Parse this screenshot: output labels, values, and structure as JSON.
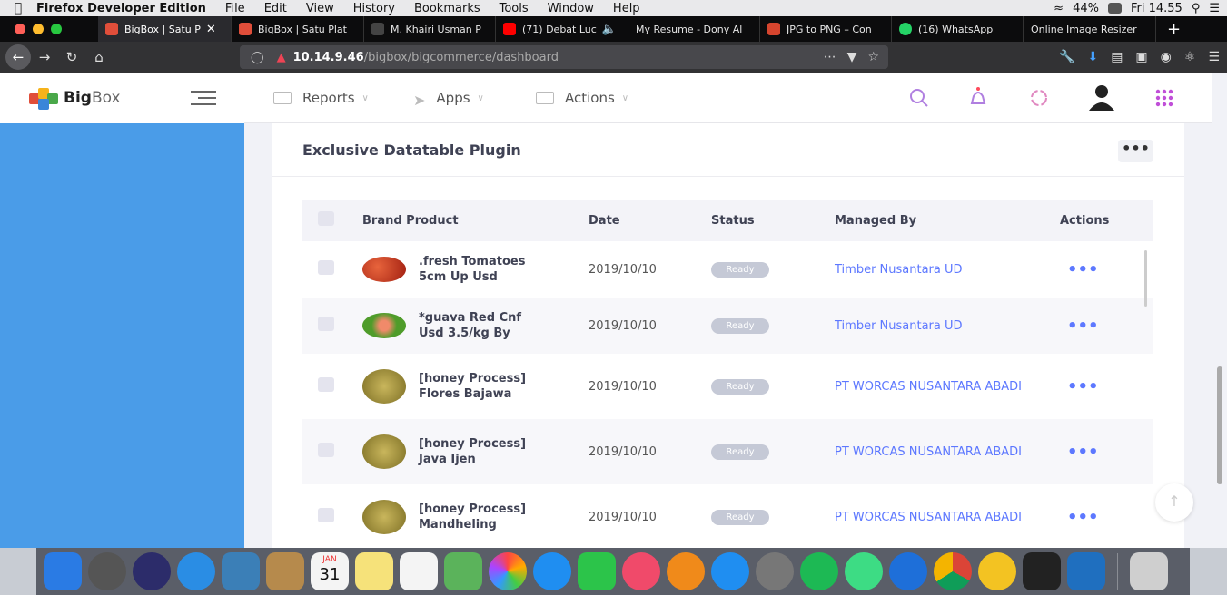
{
  "menubar": {
    "app": "Firefox Developer Edition",
    "items": [
      "File",
      "Edit",
      "View",
      "History",
      "Bookmarks",
      "Tools",
      "Window",
      "Help"
    ],
    "battery": "44%",
    "clock": "Fri 14.55"
  },
  "tabs": [
    {
      "label": "BigBox | Satu P",
      "color": "#e04e3a",
      "active": true
    },
    {
      "label": "BigBox | Satu Plat",
      "color": "#e04e3a",
      "active": false
    },
    {
      "label": "M. Khairi Usman P",
      "color": "#444",
      "active": false
    },
    {
      "label": "(71) Debat Luc",
      "color": "#ff0000",
      "active": false
    },
    {
      "label": "My Resume - Dony Al",
      "color": "#444",
      "active": false
    },
    {
      "label": "JPG to PNG – Con",
      "color": "#d6452e",
      "active": false
    },
    {
      "label": "(16) WhatsApp",
      "color": "#25d366",
      "active": false
    },
    {
      "label": "Online Image Resizer",
      "color": "#444",
      "active": false
    }
  ],
  "url": {
    "host": "10.14.9.46",
    "path": "/bigbox/bigcommerce/dashboard"
  },
  "brand": {
    "name_bold": "Big",
    "name_light": "Box"
  },
  "nav": {
    "reports": "Reports",
    "apps": "Apps",
    "actions": "Actions"
  },
  "card": {
    "title": "Exclusive Datatable Plugin",
    "more": "•••"
  },
  "table": {
    "headers": {
      "brand": "Brand Product",
      "date": "Date",
      "status": "Status",
      "managed": "Managed By",
      "actions": "Actions"
    },
    "rows": [
      {
        "name": ".fresh Tomatoes 5cm Up Usd",
        "date": "2019/10/10",
        "status": "Ready",
        "managed": "Timber Nusantara UD",
        "actions": "•••",
        "img": "#c0321e"
      },
      {
        "name": "*guava Red Cnf Usd 3.5/kg By",
        "date": "2019/10/10",
        "status": "Ready",
        "managed": "Timber Nusantara UD",
        "actions": "•••",
        "img": "#5e9e2c"
      },
      {
        "name": "[honey Process] Flores Bajawa",
        "date": "2019/10/10",
        "status": "Ready",
        "managed": "PT WORCAS NUSANTARA ABADI",
        "actions": "•••",
        "img": "#a89a3c"
      },
      {
        "name": "[honey Process] Java Ijen",
        "date": "2019/10/10",
        "status": "Ready",
        "managed": "PT WORCAS NUSANTARA ABADI",
        "actions": "•••",
        "img": "#a89a3c"
      },
      {
        "name": "[honey Process] Mandheling",
        "date": "2019/10/10",
        "status": "Ready",
        "managed": "PT WORCAS NUSANTARA ABADI",
        "actions": "•••",
        "img": "#a89a3c"
      }
    ]
  },
  "dock": [
    "finder-icon",
    "launchpad-icon",
    "siri-icon",
    "safari-icon",
    "preview-icon",
    "contacts-icon",
    "calendar-icon",
    "notes-icon",
    "reminders-icon",
    "maps-icon",
    "photos-icon",
    "messages-icon",
    "facetime-icon",
    "music-icon",
    "books-icon",
    "app-store-icon",
    "system-preferences-icon",
    "spotify-icon",
    "android-studio-icon",
    "firefox-dev-icon",
    "chrome-icon",
    "cyberduck-icon",
    "terminal-icon",
    "vscode-icon",
    "trash-icon"
  ],
  "dock_colors": [
    "#2a7be4",
    "#444",
    "#3a3a7a",
    "#2a8de4",
    "#3b7fb7",
    "#b68a4c",
    "#f4f4f4",
    "#f6e27a",
    "#f4f4f4",
    "#5bb35b",
    "#f0f0f0",
    "#1f8ef1",
    "#2cc44a",
    "#f04a6a",
    "#f08a1a",
    "#1f8ef1",
    "#777",
    "#1db954",
    "#3ddc84",
    "#1e6fd9",
    "#d64a2e",
    "#f3c322",
    "#222",
    "#1f6fbf",
    "#cfcfcf"
  ],
  "calendar": {
    "month": "JAN",
    "day": "31"
  }
}
